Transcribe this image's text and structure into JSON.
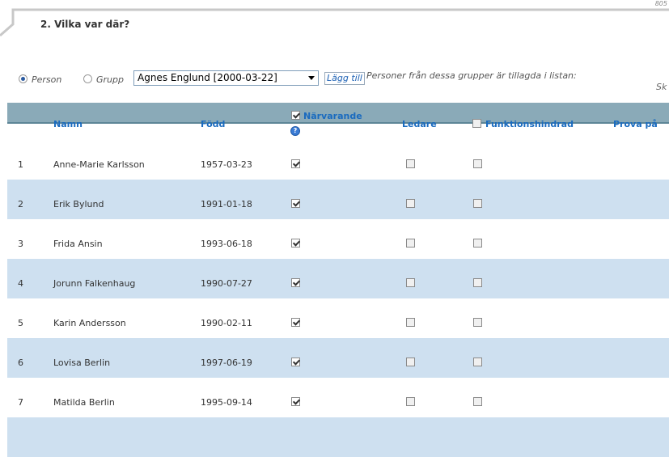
{
  "page_number": "805",
  "section_title": "2. Vilka var där?",
  "controls": {
    "radio_person": "Person",
    "radio_group": "Grupp",
    "selected_person": "Agnes Englund [2000-03-22]",
    "add_button": "Lägg till",
    "info_text": "Personer från dessa grupper är tillagda i listan:",
    "cut_text": "Sk"
  },
  "table": {
    "headers": {
      "name": "Namn",
      "born": "Född",
      "present": "Närvarande",
      "leader": "Ledare",
      "disability": "Funktionshindrad",
      "trial": "Prova på"
    },
    "rows": [
      {
        "num": "1",
        "name": "Anne-Marie Karlsson",
        "born": "1957-03-23",
        "present": true,
        "leader": false,
        "disability": false
      },
      {
        "num": "2",
        "name": "Erik Bylund",
        "born": "1991-01-18",
        "present": true,
        "leader": false,
        "disability": false
      },
      {
        "num": "3",
        "name": "Frida Ansin",
        "born": "1993-06-18",
        "present": true,
        "leader": false,
        "disability": false
      },
      {
        "num": "4",
        "name": "Jorunn Falkenhaug",
        "born": "1990-07-27",
        "present": true,
        "leader": false,
        "disability": false
      },
      {
        "num": "5",
        "name": "Karin Andersson",
        "born": "1990-02-11",
        "present": true,
        "leader": false,
        "disability": false
      },
      {
        "num": "6",
        "name": "Lovisa Berlin",
        "born": "1997-06-19",
        "present": true,
        "leader": false,
        "disability": false
      },
      {
        "num": "7",
        "name": "Matilda Berlin",
        "born": "1995-09-14",
        "present": true,
        "leader": false,
        "disability": false
      }
    ]
  },
  "colors": {
    "header_band": "#8aaab8",
    "alt_row": "#cee0f0",
    "link_blue": "#1a6bbf"
  }
}
